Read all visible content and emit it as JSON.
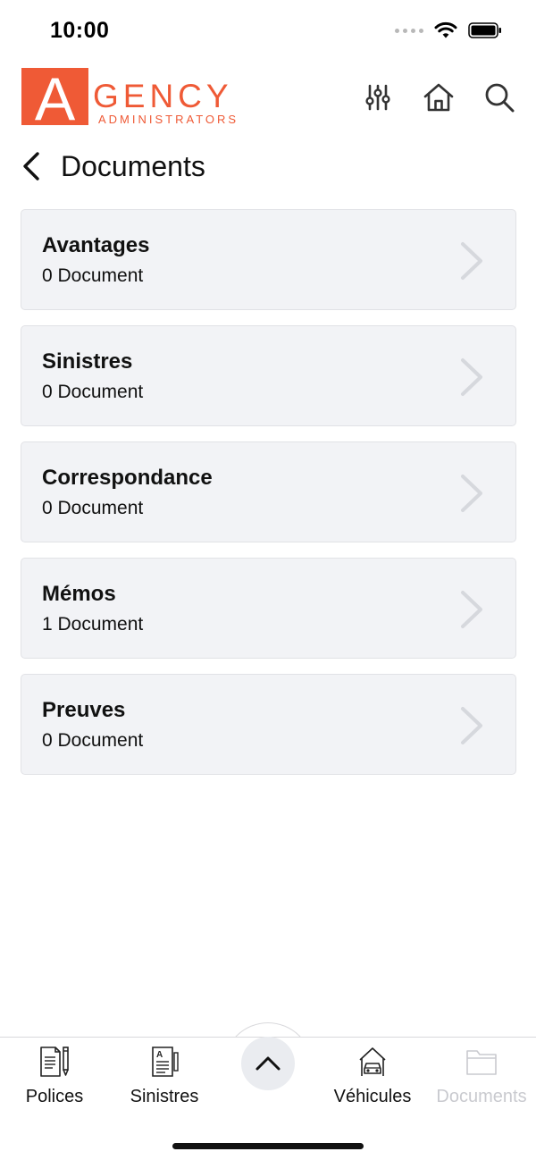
{
  "status_bar": {
    "time": "10:00",
    "icons": [
      "signal-dots-icon",
      "wifi-icon",
      "battery-icon"
    ]
  },
  "header": {
    "logo": {
      "letter": "A",
      "word": "GENCY",
      "subtitle": "ADMINISTRATORS",
      "brand_color": "#ef5a36"
    },
    "icons": [
      "filter-sliders-icon",
      "home-icon",
      "search-icon"
    ]
  },
  "page": {
    "title": "Documents",
    "back_icon": "chevron-left-icon"
  },
  "categories": [
    {
      "title": "Avantages",
      "count_label": "0 Document"
    },
    {
      "title": "Sinistres",
      "count_label": "0 Document"
    },
    {
      "title": "Correspondance",
      "count_label": "0 Document"
    },
    {
      "title": "Mémos",
      "count_label": "1 Document"
    },
    {
      "title": "Preuves",
      "count_label": "0 Document"
    }
  ],
  "bottom_nav": {
    "items": [
      {
        "label": "Polices",
        "icon": "policy-document-icon",
        "active": true
      },
      {
        "label": "Sinistres",
        "icon": "claims-document-icon",
        "active": true
      },
      {
        "label": "Véhicules",
        "icon": "car-garage-icon",
        "active": true
      },
      {
        "label": "Documents",
        "icon": "folder-icon",
        "active": false
      }
    ],
    "center_button_icon": "chevron-up-icon"
  },
  "colors": {
    "brand": "#ef5a36",
    "card_bg": "#f2f3f6",
    "chevron": "#d6d8dd",
    "disabled_text": "#c9cacf"
  }
}
